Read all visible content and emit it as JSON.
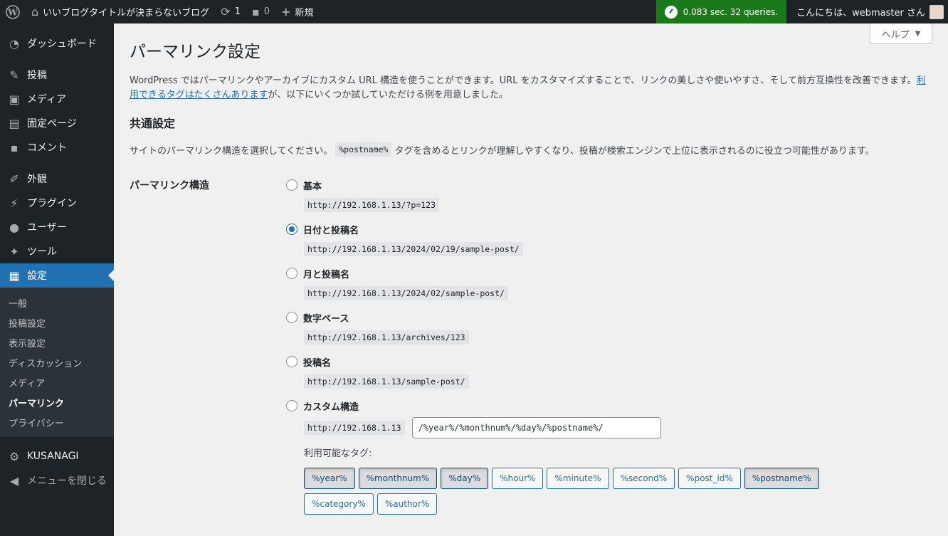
{
  "adminbar": {
    "site_title": "いいブログタイトルが決まらないブログ",
    "updates_count": "1",
    "comments_count": "0",
    "new_label": "新規",
    "perf": "0.083 sec. 32 queries.",
    "greeting": "こんにちは、webmaster さん"
  },
  "sidebar": {
    "items": [
      {
        "label": "ダッシュボード",
        "icon": "dashboard-icon"
      },
      {
        "label": "投稿",
        "icon": "pin-icon"
      },
      {
        "label": "メディア",
        "icon": "media-icon"
      },
      {
        "label": "固定ページ",
        "icon": "page-icon"
      },
      {
        "label": "コメント",
        "icon": "comment-icon"
      },
      {
        "label": "外観",
        "icon": "brush-icon"
      },
      {
        "label": "プラグイン",
        "icon": "plugin-icon"
      },
      {
        "label": "ユーザー",
        "icon": "user-icon"
      },
      {
        "label": "ツール",
        "icon": "wrench-icon"
      },
      {
        "label": "設定",
        "icon": "settings-icon"
      }
    ],
    "submenu": [
      "一般",
      "投稿設定",
      "表示設定",
      "ディスカッション",
      "メディア",
      "パーマリンク",
      "プライバシー"
    ],
    "active_sub": "パーマリンク",
    "kusanagi": "KUSANAGI",
    "collapse": "メニューを閉じる"
  },
  "help_tab": "ヘルプ",
  "page_title": "パーマリンク設定",
  "intro_text": "WordPress ではパーマリンクやアーカイブにカスタム URL 構造を使うことができます。URL をカスタマイズすることで、リンクの美しさや使いやすさ、そして前方互換性を改善できます。",
  "intro_link": "利用できるタグはたくさんあります",
  "intro_tail": "が、以下にいくつか試していただける例を用意しました。",
  "section_title": "共通設定",
  "section_desc_before": "サイトのパーマリンク構造を選択してください。",
  "section_desc_code": "%postname%",
  "section_desc_after": "タグを含めるとリンクが理解しやすくなり、投稿が検索エンジンで上位に表示されるのに役立つ可能性があります。",
  "field_label": "パーマリンク構造",
  "options": [
    {
      "label": "基本",
      "example": "http://192.168.1.13/?p=123",
      "checked": false
    },
    {
      "label": "日付と投稿名",
      "example": "http://192.168.1.13/2024/02/19/sample-post/",
      "checked": true
    },
    {
      "label": "月と投稿名",
      "example": "http://192.168.1.13/2024/02/sample-post/",
      "checked": false
    },
    {
      "label": "数字ベース",
      "example": "http://192.168.1.13/archives/123",
      "checked": false
    },
    {
      "label": "投稿名",
      "example": "http://192.168.1.13/sample-post/",
      "checked": false
    }
  ],
  "custom": {
    "label": "カスタム構造",
    "prefix": "http://192.168.1.13",
    "value": "/%year%/%monthnum%/%day%/%postname%/"
  },
  "tags_label": "利用可能なタグ:",
  "tags": [
    {
      "label": "%year%",
      "active": true
    },
    {
      "label": "%monthnum%",
      "active": true
    },
    {
      "label": "%day%",
      "active": true
    },
    {
      "label": "%hour%",
      "active": false
    },
    {
      "label": "%minute%",
      "active": false
    },
    {
      "label": "%second%",
      "active": false
    },
    {
      "label": "%post_id%",
      "active": false
    },
    {
      "label": "%postname%",
      "active": true
    },
    {
      "label": "%category%",
      "active": false
    },
    {
      "label": "%author%",
      "active": false
    }
  ]
}
